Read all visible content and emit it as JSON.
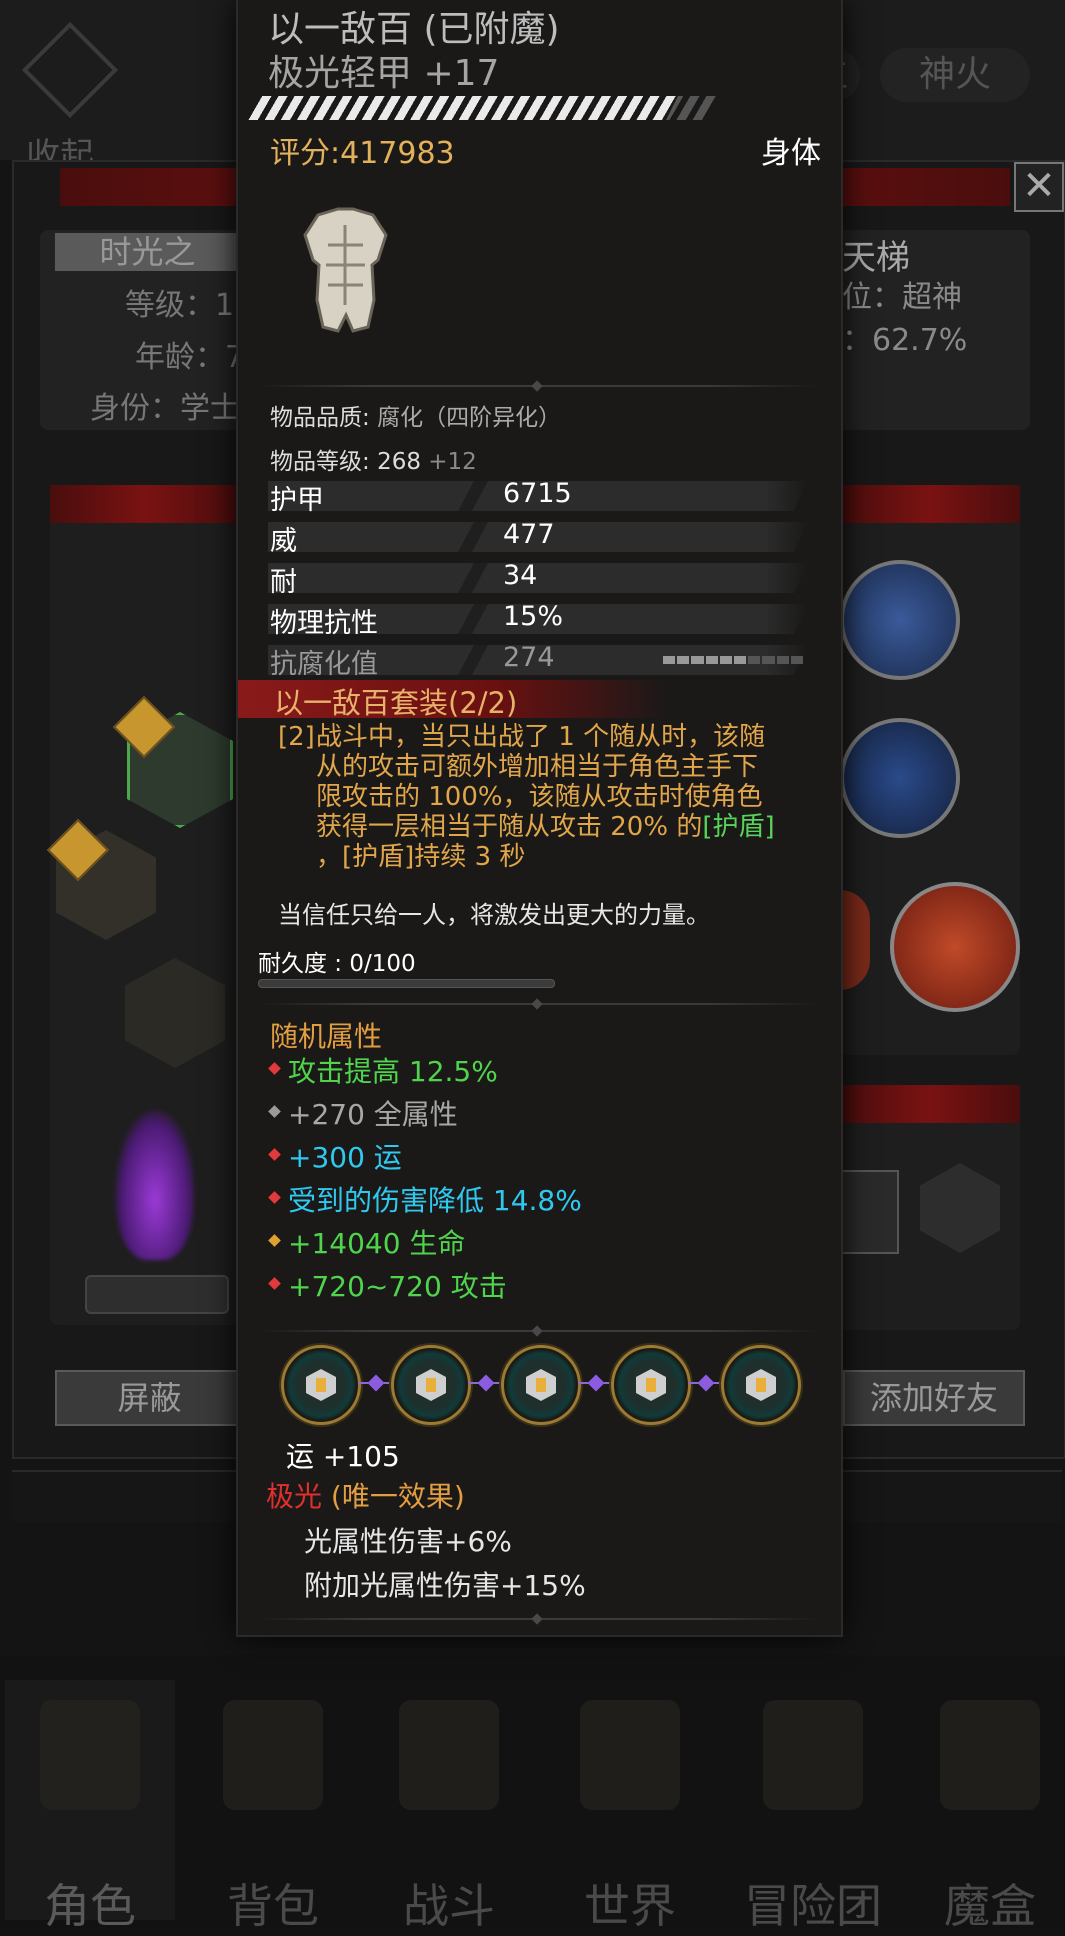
{
  "background": {
    "collapse_label": "收起",
    "top_tabs": [
      "位",
      "神火"
    ],
    "char_title": "时光之",
    "left_info": [
      "等级：1",
      "年龄：7",
      "身份：学士"
    ],
    "right_info": {
      "title": "天梯",
      "rank": "位：超神",
      "rate": "：62.7%"
    },
    "buttons": {
      "block": "屏蔽",
      "add_friend": "添加好友"
    }
  },
  "tooltip": {
    "name": "以一敌百",
    "enchant": "(已附魔)",
    "item_name": "极光轻甲 +17",
    "score_label": "评分:417983",
    "slot": "身体",
    "armor_icon": "armor-chestplate-icon",
    "quality_label": "物品品质:",
    "quality_value": "腐化（四阶异化）",
    "level_label": "物品等级:",
    "level_value": "268",
    "level_bonus": "+12",
    "stats": [
      {
        "key": "护甲",
        "value": "6715"
      },
      {
        "key": "威",
        "value": "477"
      },
      {
        "key": "耐",
        "value": "34"
      },
      {
        "key": "物理抗性",
        "value": "15%"
      },
      {
        "key": "抗腐化值",
        "value": "274"
      }
    ],
    "corruption_segments_filled": 6,
    "corruption_segments_total": 10,
    "set_title": "以一敌百套装(2/2)",
    "set_num": "[2]",
    "set_lines": [
      "战斗中，当只出战了 1 个随从时，该随",
      "从的攻击可额外增加相当于角色主手下",
      "限攻击的 100%，该随从攻击时使角色",
      "获得一层相当于随从攻击 20% 的"
    ],
    "set_shield_tag": "[护盾]",
    "set_last_prefix": "，",
    "set_last_tag": "[护盾]",
    "set_last_rest": "持续 3 秒",
    "flavor": "当信任只给一人，将激发出更大的力量。",
    "durability": "耐久度 : 0/100",
    "durability_fraction": 0,
    "random_title": "随机属性",
    "random_attrs": [
      {
        "text": "攻击提高 12.5%",
        "color": "#4fd44c",
        "gem": "#e03a3a"
      },
      {
        "text": "+270 全属性",
        "color": "#a8a8a8",
        "gem": "#9a9a9a"
      },
      {
        "text": "+300 运",
        "color": "#2fc9f0",
        "gem": "#e03a3a"
      },
      {
        "text": "受到的伤害降低 14.8%",
        "color": "#2fc9f0",
        "gem": "#e03a3a"
      },
      {
        "text": "+14040 生命",
        "color": "#4fd44c",
        "gem": "#e0a030"
      },
      {
        "text": "+720~720 攻击",
        "color": "#4fd44c",
        "gem": "#e03a3a"
      }
    ],
    "socket_count": 5,
    "socket_bonus": "运  +105",
    "unique_name": "极光",
    "unique_tag": "(唯一效果)",
    "unique_lines": [
      "光属性伤害+6%",
      "附加光属性伤害+15%"
    ]
  },
  "nav": [
    "角色",
    "背包",
    "战斗",
    "世界",
    "冒险团",
    "魔盒"
  ],
  "colors": {
    "gold": "#e3b15a",
    "set_orange": "#e1a64a",
    "green": "#57d35a",
    "cyan": "#2fc9f0",
    "red": "#e0302c"
  }
}
